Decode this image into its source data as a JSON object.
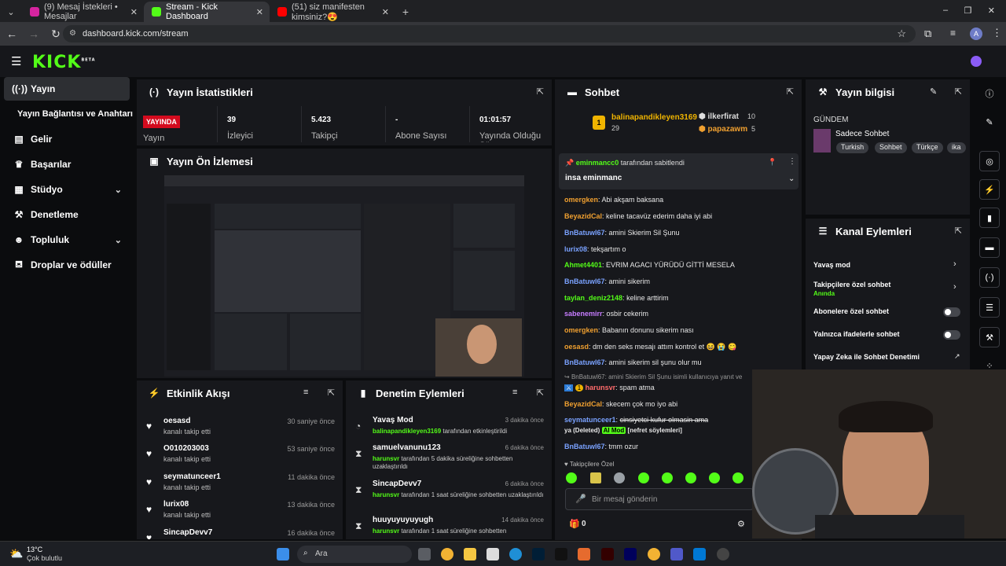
{
  "browser": {
    "tabs": [
      {
        "label": "(9) Mesaj İstekleri • Mesajlar",
        "color": "#d6249f"
      },
      {
        "label": "Stream - Kick Dashboard",
        "color": "#53fc18"
      },
      {
        "label": "(51) siz manifesten kimsiniz?😍",
        "color": "#ff0000"
      }
    ],
    "url": "dashboard.kick.com/stream",
    "profile_initial": "A"
  },
  "header": {
    "logo": "KICK",
    "logo_sup": "BETA"
  },
  "sidebar": {
    "items": [
      {
        "label": "Yayın",
        "icon": "broadcast-icon"
      },
      {
        "label": "Yayın Bağlantısı ve Anahtarı"
      },
      {
        "label": "Gelir",
        "icon": "wallet-icon"
      },
      {
        "label": "Başarılar",
        "icon": "trophy-icon"
      },
      {
        "label": "Stüdyo",
        "icon": "studio-icon"
      },
      {
        "label": "Denetleme",
        "icon": "wrench-icon"
      },
      {
        "label": "Topluluk",
        "icon": "community-icon"
      },
      {
        "label": "Droplar ve ödüller",
        "icon": "drops-icon"
      }
    ]
  },
  "stats": {
    "title": "Yayın İstatistikleri",
    "live_badge": "YAYINDA",
    "live_label": "Yayın",
    "items": [
      {
        "value": "39",
        "label": "İzleyici"
      },
      {
        "value": "5.423",
        "label": "Takipçi"
      },
      {
        "value": "-",
        "label": "Abone Sayısı"
      },
      {
        "value": "01:01:57",
        "label": "Yayında Olduğu Süre"
      }
    ]
  },
  "preview": {
    "title": "Yayın Ön İzlemesi"
  },
  "activity": {
    "title": "Etkinlik Akışı",
    "items": [
      {
        "user": "oesasd",
        "action": "kanalı takip etti",
        "time": "30 saniye önce"
      },
      {
        "user": "O010203003",
        "action": "kanalı takip etti",
        "time": "53 saniye önce"
      },
      {
        "user": "seymatunceer1",
        "action": "kanalı takip etti",
        "time": "11 dakika önce"
      },
      {
        "user": "lurix08",
        "action": "kanalı takip etti",
        "time": "13 dakika önce"
      },
      {
        "user": "SincapDevv7",
        "action": "",
        "time": "16 dakika önce"
      }
    ]
  },
  "moderation": {
    "title": "Denetim Eylemleri",
    "items": [
      {
        "title": "Yavaş Mod",
        "who": "balinapandikleyen3169",
        "rest": " tarafından etkinleştirildi",
        "time": "3 dakika önce"
      },
      {
        "title": "samuelvanunu123",
        "who": "harunsvr",
        "rest": " tarafından 5 dakika süreliğine sohbetten uzaklaştırıldı",
        "time": "6 dakika önce"
      },
      {
        "title": "SincapDevv7",
        "who": "harunsvr",
        "rest": " tarafından 1 saat süreliğine sohbetten uzaklaştırıldı",
        "time": "6 dakika önce"
      },
      {
        "title": "huuyuyuyuyugh",
        "who": "harunsvr",
        "rest": " tarafından 1 saat süreliğine sohbetten",
        "time": "14 dakika önce"
      }
    ]
  },
  "chat": {
    "title": "Sohbet",
    "top": [
      {
        "name": "balinapandikleyen3169",
        "count": "29"
      },
      {
        "name": "ilkerfirat",
        "count": "10"
      },
      {
        "name": "papazawm",
        "count": "5"
      }
    ],
    "pinned_by": "eminmancc0",
    "pinned_suffix": "tarafından sabitlendi",
    "pinned_text": "insa eminmanc",
    "messages": [
      {
        "user": "omergken",
        "color": "#f0a030",
        "text": "Abi akşam baksana"
      },
      {
        "user": "BeyazidCal",
        "color": "#f0a030",
        "text": "keline tacavüz ederim daha iyi abi"
      },
      {
        "user": "BnBatuwl67",
        "color": "#7aa2ff",
        "text": "amini Skierim Sil Şunu"
      },
      {
        "user": "lurix08",
        "color": "#7aa2ff",
        "text": "tekşartım o"
      },
      {
        "user": "Ahmet4401",
        "color": "#53fc18",
        "text": "EVRIM AGACI YÜRÜDÜ GİTTİ MESELA"
      },
      {
        "user": "BnBatuwl67",
        "color": "#7aa2ff",
        "text": "amini sikerim"
      },
      {
        "user": "taylan_deniz2148",
        "color": "#53fc18",
        "text": "keline arttirim"
      },
      {
        "user": "sabenemirr",
        "color": "#c77dff",
        "text": "osbir cekerim"
      },
      {
        "user": "omergken",
        "color": "#f0a030",
        "text": "Babanın donunu sikerim nası"
      },
      {
        "user": "oesasd",
        "color": "#f0a030",
        "text": "dm den seks mesajı attım kontrol et 😆 😭 😋"
      },
      {
        "user": "BnBatuwl67",
        "color": "#7aa2ff",
        "text": "amini sikerim sil şunu olur mu"
      }
    ],
    "reply_line": "BnBatuwl67: amini Skierim Sil Şunu isimli kullanıcıya yanıt ve",
    "mod_msg_user": "harunsvr",
    "mod_msg_text": "spam atma",
    "msg2_user": "BeyazidCal",
    "msg2_text": "skecem çok mo iyo abi",
    "msg3_user": "seymatunceer1",
    "msg3_text": "cinsiyetci kufur olmasin ama",
    "msg3_line2a": "ya (Deleted)",
    "msg3_badge": "AI Mod",
    "msg3_line2b": "[nefret söylemleri]",
    "msg4_user": "BnBatuwl67",
    "msg4_text": "tmm ozur",
    "followers_only": "Takipçilere Özel",
    "input_placeholder": "Bir mesaj gönderin",
    "count": "0"
  },
  "stream_info": {
    "title": "Yayın bilgisi",
    "section": "GÜNDEM",
    "category": "Sadece Sohbet",
    "tags": [
      "Turkish",
      "Sohbet",
      "Türkçe",
      "ika"
    ]
  },
  "channel_actions": {
    "title": "Kanal Eylemleri",
    "slow": "Yavaş mod",
    "followers": "Takipçilere özel sohbet",
    "followers_sub": "Anında",
    "subs": "Abonelere özel sohbet",
    "emotes": "Yalnızca ifadelerle sohbet",
    "ai": "Yapay Zeka ile Sohbet Denetimi"
  },
  "taskbar": {
    "temp": "13°C",
    "weather": "Çok bulutlu",
    "search": "Ara"
  }
}
